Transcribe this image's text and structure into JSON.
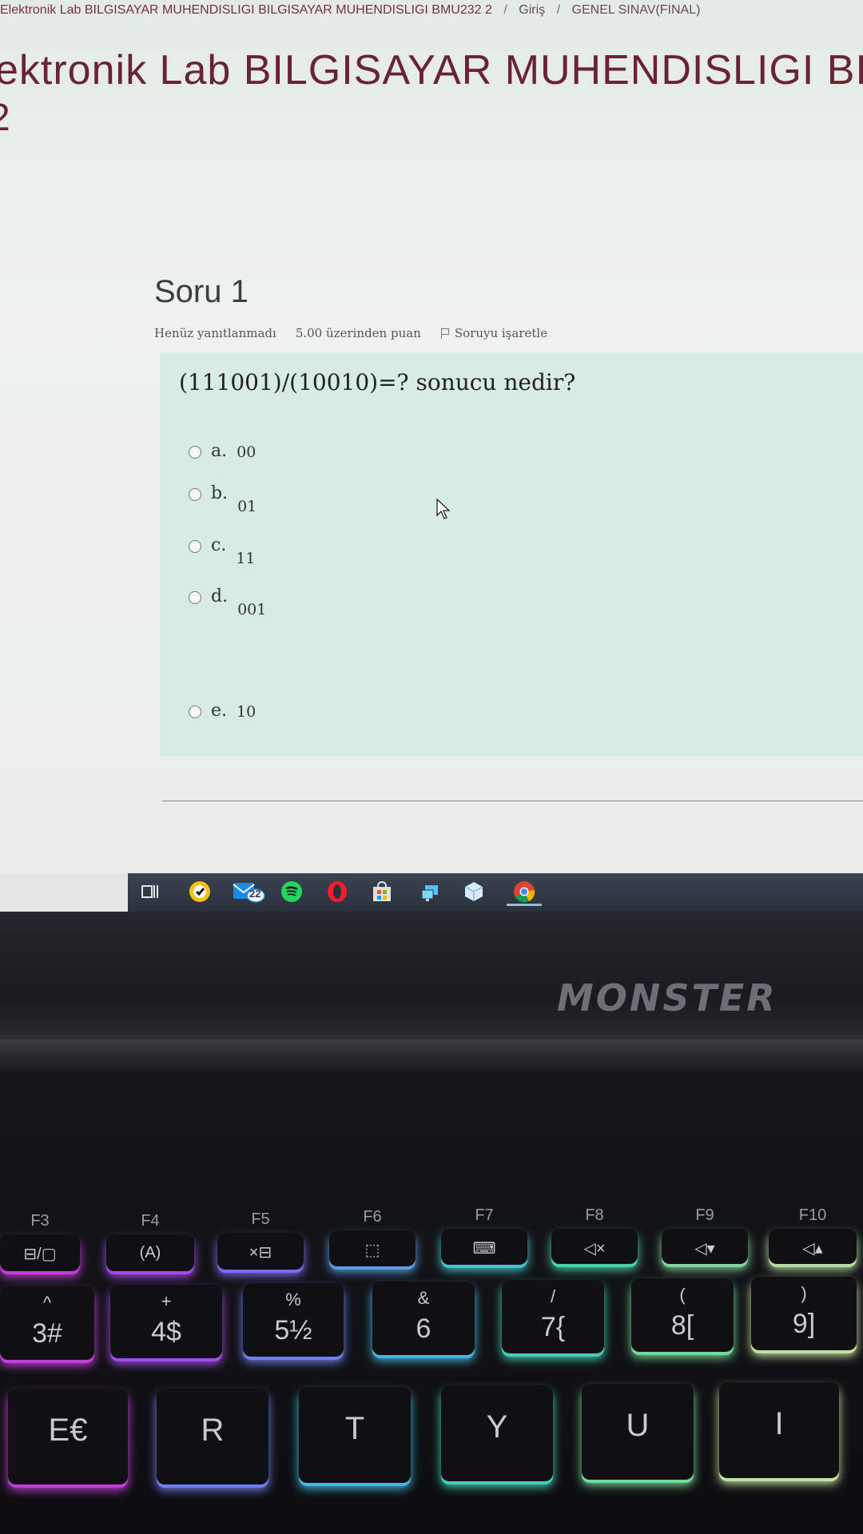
{
  "breadcrumb": [
    "Elektronik Lab BILGISAYAR MUHENDISLIGI BILGISAYAR MUHENDISLIGI BMU232 2",
    "Giriş",
    "GENEL SINAV(FİNAL)"
  ],
  "breadcrumb_sep": "/",
  "course_title": "ektronik Lab BILGISAYAR MUHENDISLIGI BIL",
  "course_title_line2": "2",
  "question": {
    "number_label": "Soru 1",
    "status": "Henüz yanıtlanmadı",
    "points": "5.00 üzerinden puan",
    "flag_label": "Soruyu işaretle",
    "text": "(111001)/(10010)=? sonucu nedir?",
    "options": [
      {
        "letter": "a.",
        "value": "00"
      },
      {
        "letter": "b.",
        "value": "01"
      },
      {
        "letter": "c.",
        "value": "11"
      },
      {
        "letter": "d.",
        "value": "001"
      },
      {
        "letter": "e.",
        "value": "10"
      }
    ]
  },
  "taskbar": {
    "icons": [
      "task-view-icon",
      "norton-icon",
      "mail-icon",
      "spotify-icon",
      "opera-icon",
      "store-icon",
      "network-icon",
      "box-icon",
      "chrome-icon"
    ],
    "mail_badge": "22"
  },
  "laptop": {
    "brand": "MONSTER",
    "fkeys": [
      {
        "label": "F3",
        "icon": "⊟/▢"
      },
      {
        "label": "F4",
        "icon": "(A)"
      },
      {
        "label": "F5",
        "icon": "×⊟"
      },
      {
        "label": "F6",
        "icon": "⬚"
      },
      {
        "label": "F7",
        "icon": "⌨"
      },
      {
        "label": "F8",
        "icon": "◁×"
      },
      {
        "label": "F9",
        "icon": "◁▾"
      },
      {
        "label": "F10",
        "icon": "◁▴"
      }
    ],
    "numkeys": [
      {
        "top": "^",
        "main": "3#"
      },
      {
        "top": "+",
        "main": "4$"
      },
      {
        "top": "%",
        "main": "5½"
      },
      {
        "top": "&",
        "main": "6"
      },
      {
        "top": "/",
        "main": "7{"
      },
      {
        "top": "(",
        "main": "8["
      },
      {
        "top": ")",
        "main": "9]"
      }
    ],
    "letterkeys": [
      "E€",
      "R",
      "T",
      "Y",
      "U",
      "I"
    ]
  },
  "colors": {
    "breadcrumb": "#7a2f3c",
    "title": "#6a2330",
    "question_box": "#d8ebe4",
    "taskbar": "#2f3640"
  }
}
